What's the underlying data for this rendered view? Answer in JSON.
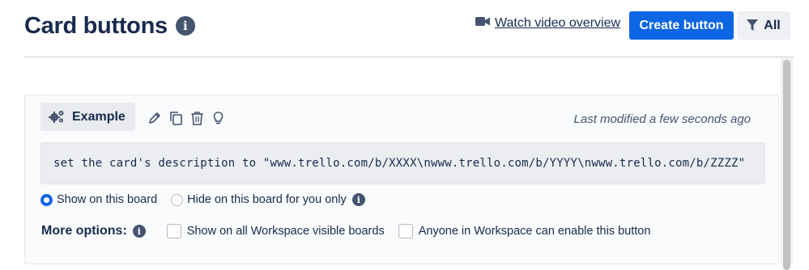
{
  "header": {
    "title": "Card buttons",
    "info_icon": "info-icon",
    "watch_link": "Watch video overview",
    "watch_icon": "video-camera-icon",
    "create_button": "Create button",
    "filter_label": "All",
    "filter_icon": "filter-icon",
    "accent_color": "#0c66e4"
  },
  "card": {
    "name": "Example",
    "name_icon": "gears-icon",
    "tools": [
      "pencil-icon",
      "copy-icon",
      "trash-icon",
      "lightbulb-icon"
    ],
    "last_modified": "Last modified a few seconds ago",
    "command": "set the card's description to \"www.trello.com/b/XXXX\\nwww.trello.com/b/YYYY\\nwww.trello.com/b/ZZZZ\"",
    "visibility": {
      "show_label": "Show on this board",
      "hide_label": "Hide on this board for you only",
      "selected": "show"
    },
    "more_options": {
      "label": "More options:",
      "option1": "Show on all Workspace visible boards",
      "option1_checked": false,
      "option2": "Anyone in Workspace can enable this button",
      "option2_checked": false
    }
  }
}
